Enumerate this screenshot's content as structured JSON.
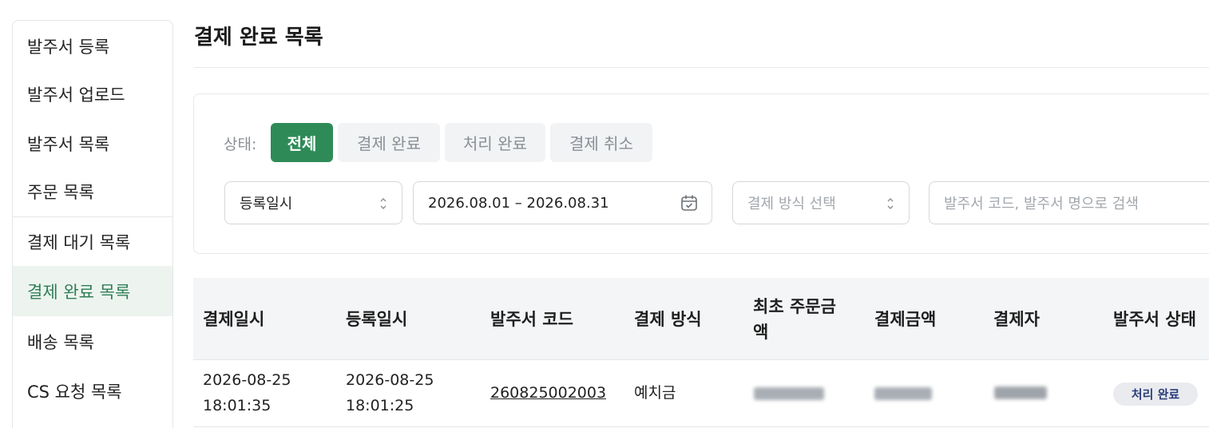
{
  "sidebar": {
    "items": [
      {
        "label": "발주서 등록"
      },
      {
        "label": "발주서 업로드"
      },
      {
        "label": "발주서 목록"
      },
      {
        "label": "주문 목록"
      },
      {
        "label": "결제 대기 목록"
      },
      {
        "label": "결제 완료 목록"
      },
      {
        "label": "배송 목록"
      },
      {
        "label": "CS 요청 목록"
      }
    ],
    "active_index": 5
  },
  "page": {
    "title": "결제 완료 목록"
  },
  "filters": {
    "status_label": "상태:",
    "chips": [
      {
        "label": "전체",
        "active": true
      },
      {
        "label": "결제 완료",
        "active": false
      },
      {
        "label": "처리 완료",
        "active": false
      },
      {
        "label": "결제 취소",
        "active": false
      }
    ],
    "date_type": "등록일시",
    "date_range": "2026.08.01 – 2026.08.31",
    "payment_method_placeholder": "결제 방식 선택",
    "search_placeholder": "발주서 코드, 발주서 명으로 검색"
  },
  "table": {
    "headers": [
      "결제일시",
      "등록일시",
      "발주서 코드",
      "결제 방식",
      "최초 주문금",
      "액",
      "결제금액",
      "결제자",
      "발주서 상태"
    ],
    "rows": [
      {
        "paid_date": "2026-08-25",
        "paid_time": "18:01:35",
        "reg_date": "2026-08-25",
        "reg_time": "18:01:25",
        "code": "260825002003",
        "method": "예치금",
        "status": "처리 완료"
      }
    ]
  },
  "colors": {
    "accent": "#2e8b57",
    "active_sidebar_bg": "#edf4ef",
    "active_sidebar_text": "#2e7d55",
    "badge_text": "#2c3e7a"
  }
}
